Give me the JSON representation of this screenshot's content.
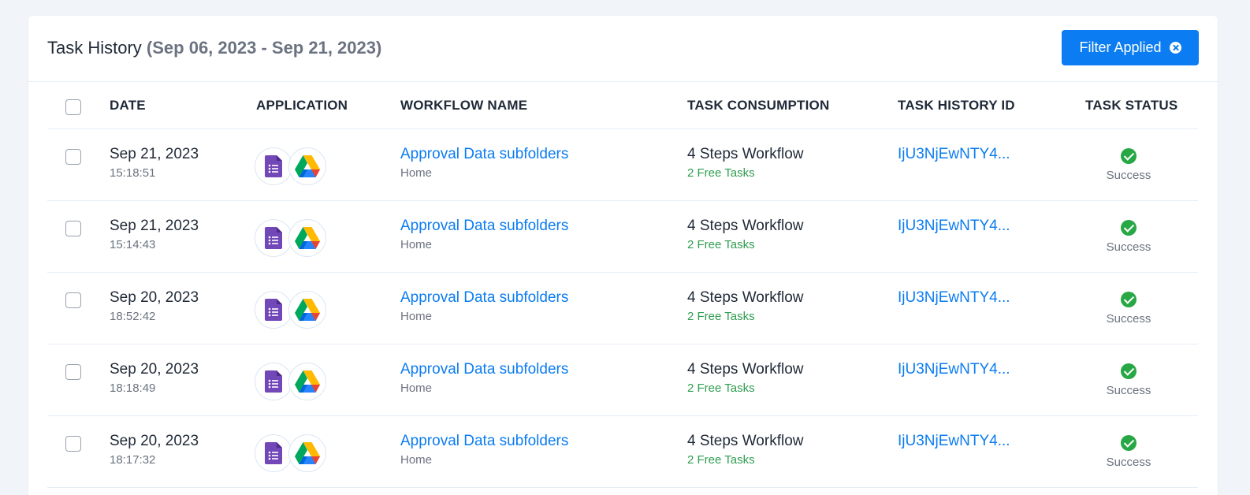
{
  "header": {
    "title": "Task History",
    "date_range": "(Sep 06, 2023 - Sep 21, 2023)",
    "filter_button": "Filter Applied"
  },
  "columns": {
    "date": "DATE",
    "application": "APPLICATION",
    "workflow_name": "WORKFLOW NAME",
    "task_consumption": "TASK CONSUMPTION",
    "task_history_id": "TASK HISTORY ID",
    "task_status": "TASK STATUS"
  },
  "rows": [
    {
      "date": "Sep 21, 2023",
      "time": "15:18:51",
      "apps": [
        "google-forms-icon",
        "google-drive-icon"
      ],
      "workflow": "Approval Data subfolders",
      "folder": "Home",
      "steps": "4 Steps Workflow",
      "free_tasks": "2 Free Tasks",
      "history_id": "IjU3NjEwNTY4...",
      "status": "Success"
    },
    {
      "date": "Sep 21, 2023",
      "time": "15:14:43",
      "apps": [
        "google-forms-icon",
        "google-drive-icon"
      ],
      "workflow": "Approval Data subfolders",
      "folder": "Home",
      "steps": "4 Steps Workflow",
      "free_tasks": "2 Free Tasks",
      "history_id": "IjU3NjEwNTY4...",
      "status": "Success"
    },
    {
      "date": "Sep 20, 2023",
      "time": "18:52:42",
      "apps": [
        "google-forms-icon",
        "google-drive-icon"
      ],
      "workflow": "Approval Data subfolders",
      "folder": "Home",
      "steps": "4 Steps Workflow",
      "free_tasks": "2 Free Tasks",
      "history_id": "IjU3NjEwNTY4...",
      "status": "Success"
    },
    {
      "date": "Sep 20, 2023",
      "time": "18:18:49",
      "apps": [
        "google-forms-icon",
        "google-drive-icon"
      ],
      "workflow": "Approval Data subfolders",
      "folder": "Home",
      "steps": "4 Steps Workflow",
      "free_tasks": "2 Free Tasks",
      "history_id": "IjU3NjEwNTY4...",
      "status": "Success"
    },
    {
      "date": "Sep 20, 2023",
      "time": "18:17:32",
      "apps": [
        "google-forms-icon",
        "google-drive-icon"
      ],
      "workflow": "Approval Data subfolders",
      "folder": "Home",
      "steps": "4 Steps Workflow",
      "free_tasks": "2 Free Tasks",
      "history_id": "IjU3NjEwNTY4...",
      "status": "Success"
    }
  ],
  "colors": {
    "accent": "#0b7cf1",
    "success": "#28a745",
    "free_tasks": "#2e9d4f",
    "forms_purple": "#7248b9"
  }
}
